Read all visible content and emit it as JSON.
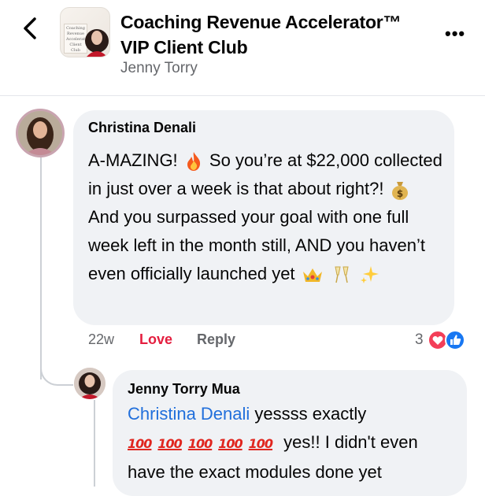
{
  "header": {
    "title_line1": "Coaching Revenue Accelerator™",
    "title_line2": "VIP Client Club",
    "subtitle": "Jenny Torry",
    "thumb_text": "Coaching Revenue Accelerator Client Club",
    "more": "•••"
  },
  "comment1": {
    "author": "Christina Denali",
    "seg1": "A-MAZING!",
    "seg2": "So you’re at $22,000 collected in just over a week is that about right?!",
    "seg3": "And you surpassed your goal with one full week left in the month still, AND you haven’t even officially launched yet",
    "emojis": [
      "fire-emoji",
      "moneybag-emoji",
      "crown-emoji",
      "champagne-emoji",
      "sparkles-emoji"
    ],
    "time": "22w",
    "reaction_label": "Love",
    "reply_label": "Reply",
    "reaction_count": "3",
    "love_color": "#e41e3f"
  },
  "comment2": {
    "author": "Jenny Torry Mua",
    "mention": "Christina Denali",
    "text1": " yessss exactly",
    "hundreds": [
      "100",
      "100",
      "100",
      "100",
      "100"
    ],
    "text2": "yes!! I didn't even have the exact modules done yet",
    "mention_color": "#216fdb"
  }
}
